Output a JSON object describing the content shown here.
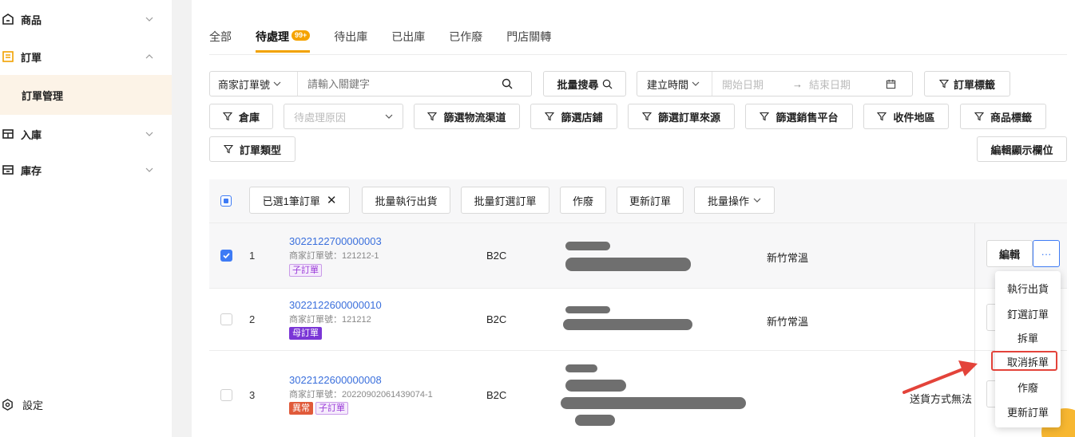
{
  "sidebar": {
    "items": [
      {
        "label": "商品",
        "icon": "product-icon"
      },
      {
        "label": "訂單",
        "icon": "order-icon"
      },
      {
        "label": "入庫",
        "icon": "inbound-icon"
      },
      {
        "label": "庫存",
        "icon": "inventory-icon"
      }
    ],
    "sub_item": "訂單管理",
    "settings": "設定"
  },
  "tabs": [
    {
      "label": "全部"
    },
    {
      "label": "待處理",
      "badge": "99+",
      "active": true
    },
    {
      "label": "待出庫"
    },
    {
      "label": "已出庫"
    },
    {
      "label": "已作廢"
    },
    {
      "label": "門店關轉"
    }
  ],
  "filters": {
    "merchant_select": "商家訂單號",
    "keyword_placeholder": "請輸入關鍵字",
    "batch_search": "批量搜尋",
    "time_select": "建立時間",
    "start_placeholder": "開始日期",
    "end_placeholder": "結束日期",
    "order_tag": "訂單標籤",
    "warehouse": "倉庫",
    "pending_reason_placeholder": "待處理原因",
    "logistics": "篩選物流渠道",
    "store": "篩選店鋪",
    "order_source": "篩選訂單來源",
    "sales_platform": "篩選銷售平台",
    "region": "收件地區",
    "product_tag": "商品標籤",
    "order_type": "訂單類型",
    "edit_columns": "編輯顯示欄位"
  },
  "toolbar": {
    "selected": "已選1筆訂單",
    "batch_ship": "批量執行出貨",
    "batch_pick": "批量釘選訂單",
    "void": "作廢",
    "update": "更新訂單",
    "batch_ops": "批量操作"
  },
  "rows": [
    {
      "index": "1",
      "order_no": "3022122700000003",
      "merchant_no": "商家訂單號：121212-1",
      "tags": [
        {
          "text": "子訂單",
          "kind": "child"
        }
      ],
      "type": "B2C",
      "warehouse": "新竹常溫",
      "checked": true
    },
    {
      "index": "2",
      "order_no": "3022122600000010",
      "merchant_no": "商家訂單號：121212",
      "tags": [
        {
          "text": "母訂單",
          "kind": "parent"
        }
      ],
      "type": "B2C",
      "warehouse": "新竹常溫",
      "checked": false
    },
    {
      "index": "3",
      "order_no": "3022122600000008",
      "merchant_no": "商家訂單號：20220902061439074-1",
      "tags": [
        {
          "text": "異常",
          "kind": "abn"
        },
        {
          "text": "子訂單",
          "kind": "child"
        }
      ],
      "type": "B2C",
      "warehouse": "",
      "note": "送貨方式無法",
      "checked": false
    }
  ],
  "actions": {
    "edit": "編輯",
    "more": "···"
  },
  "menu": [
    "執行出貨",
    "釘選訂單",
    "拆單",
    "取消拆單",
    "作廢",
    "更新訂單"
  ],
  "colors": {
    "accent": "#f2a200",
    "link": "#3a6fdc",
    "highlight": "#e3433a"
  }
}
